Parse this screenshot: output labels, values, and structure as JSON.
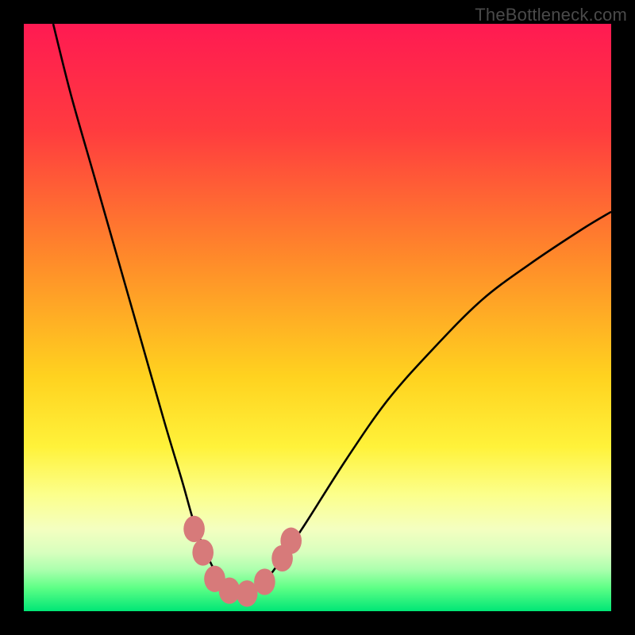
{
  "watermark": "TheBottleneck.com",
  "chart_data": {
    "type": "line",
    "title": "",
    "xlabel": "",
    "ylabel": "",
    "xlim": [
      0,
      100
    ],
    "ylim": [
      0,
      100
    ],
    "series": [
      {
        "name": "bottleneck-curve",
        "x": [
          5,
          8,
          12,
          16,
          20,
          24,
          27,
          29,
          31,
          33,
          35,
          37,
          39,
          41,
          44,
          48,
          55,
          62,
          70,
          78,
          86,
          95,
          100
        ],
        "y": [
          100,
          88,
          74,
          60,
          46,
          32,
          22,
          15,
          10,
          6,
          4,
          3,
          3.5,
          5,
          9,
          15,
          26,
          36,
          45,
          53,
          59,
          65,
          68
        ]
      }
    ],
    "markers": [
      {
        "name": "point-left-1",
        "x": 29,
        "y": 14,
        "r": 1.8
      },
      {
        "name": "point-left-2",
        "x": 30.5,
        "y": 10,
        "r": 1.8
      },
      {
        "name": "point-left-3",
        "x": 32.5,
        "y": 5.5,
        "r": 1.8
      },
      {
        "name": "point-bottom-1",
        "x": 35,
        "y": 3.5,
        "r": 1.8
      },
      {
        "name": "point-bottom-2",
        "x": 38,
        "y": 3,
        "r": 1.8
      },
      {
        "name": "point-bottom-3",
        "x": 41,
        "y": 5,
        "r": 1.8
      },
      {
        "name": "point-right-1",
        "x": 44,
        "y": 9,
        "r": 1.8
      },
      {
        "name": "point-right-2",
        "x": 45.5,
        "y": 12,
        "r": 1.8
      }
    ],
    "gradient_stops": [
      {
        "offset": 0,
        "color": "#ff1a52"
      },
      {
        "offset": 18,
        "color": "#ff3b3f"
      },
      {
        "offset": 40,
        "color": "#ff8a2a"
      },
      {
        "offset": 60,
        "color": "#ffd21f"
      },
      {
        "offset": 72,
        "color": "#fff23a"
      },
      {
        "offset": 80,
        "color": "#fcff8a"
      },
      {
        "offset": 86,
        "color": "#f4ffc0"
      },
      {
        "offset": 90,
        "color": "#d8ffbe"
      },
      {
        "offset": 93,
        "color": "#aaffad"
      },
      {
        "offset": 96,
        "color": "#5eff86"
      },
      {
        "offset": 100,
        "color": "#00e676"
      }
    ],
    "marker_color": "#d77a7a"
  }
}
